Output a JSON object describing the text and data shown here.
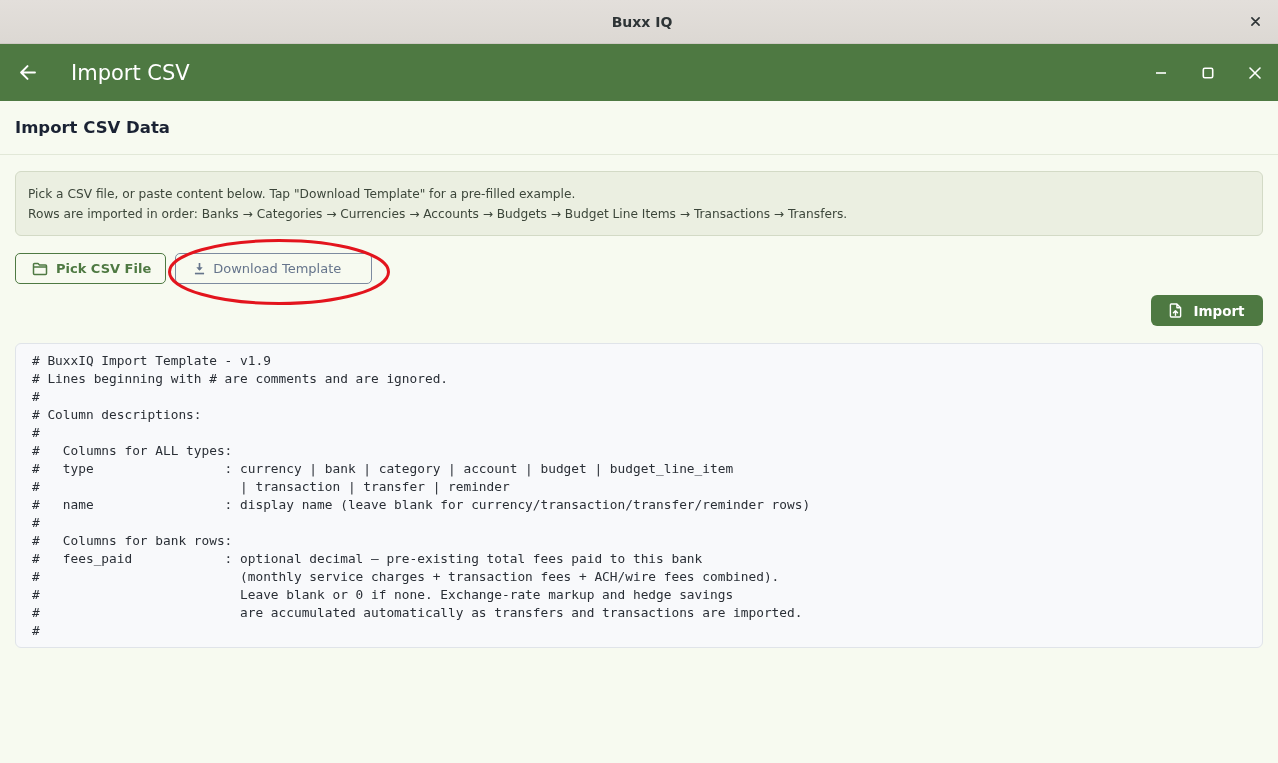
{
  "window": {
    "title": "Buxx IQ"
  },
  "app_bar": {
    "title": "Import CSV"
  },
  "page": {
    "heading": "Import CSV Data"
  },
  "info": {
    "lines": [
      "Pick a CSV file, or paste content below. Tap \"Download Template\" for a pre-filled example.",
      "Rows are imported in order: Banks → Categories → Currencies → Accounts → Budgets → Budget Line Items → Transactions → Transfers."
    ]
  },
  "actions": [
    {
      "label": "Pick CSV File",
      "kind": "pick",
      "circled": false
    },
    {
      "label": "Download Template",
      "kind": "download",
      "circled": true
    }
  ],
  "import_button": {
    "label": "Import"
  },
  "csv_editor": {
    "value": "# BuxxIQ Import Template - v1.9\n# Lines beginning with # are comments and are ignored.\n#\n# Column descriptions:\n#\n#   Columns for ALL types:\n#   type                 : currency | bank | category | account | budget | budget_line_item\n#                          | transaction | transfer | reminder\n#   name                 : display name (leave blank for currency/transaction/transfer/reminder rows)\n#\n#   Columns for bank rows:\n#   fees_paid            : optional decimal — pre-existing total fees paid to this bank\n#                          (monthly service charges + transaction fees + ACH/wire fees combined).\n#                          Leave blank or 0 if none. Exchange-rate markup and hedge savings\n#                          are accumulated automatically as transfers and transactions are imported.\n#"
  }
}
